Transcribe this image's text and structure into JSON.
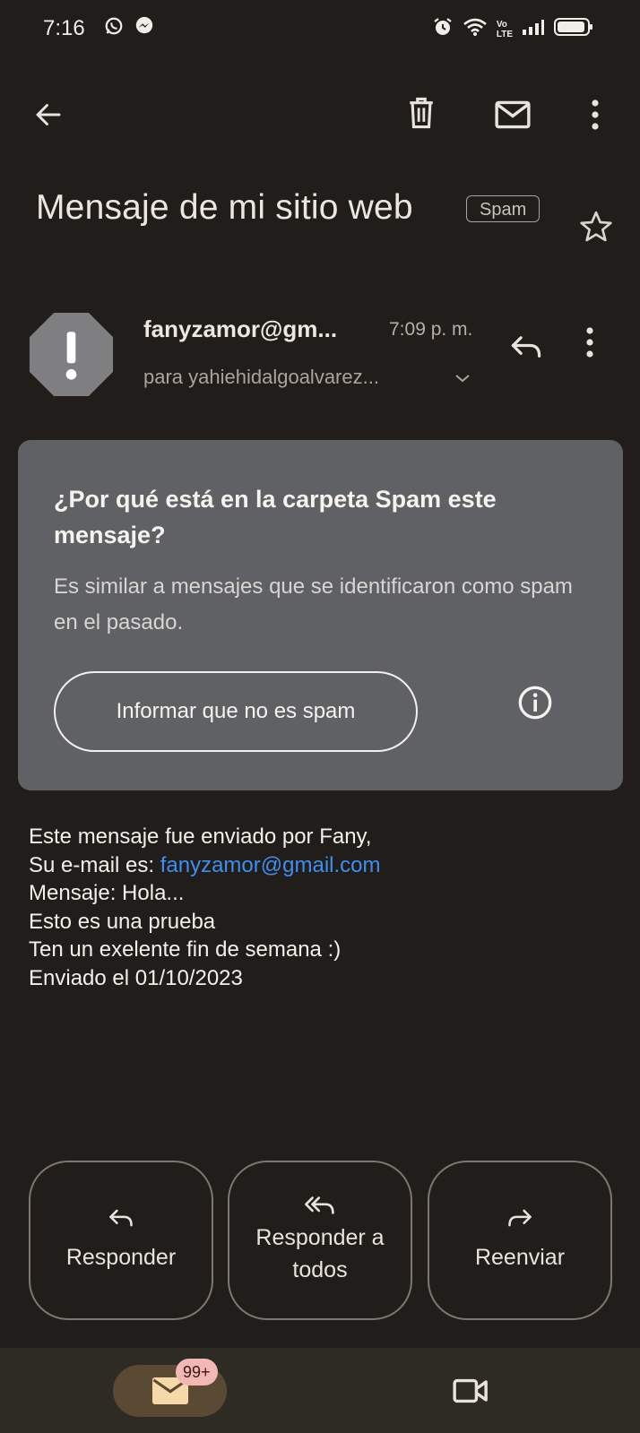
{
  "status_bar": {
    "time": "7:16",
    "left_icons": [
      "whatsapp-icon",
      "messenger-icon"
    ],
    "right_icons": [
      "alarm-icon",
      "wifi-icon",
      "volte-icon",
      "signal-icon",
      "battery-icon"
    ],
    "volte_top": "Vo",
    "volte_bottom": "LTE"
  },
  "toolbar": {
    "back_icon": "arrow-left-icon",
    "delete_icon": "trash-icon",
    "mark_unread_icon": "mail-icon",
    "more_icon": "more-vert-icon"
  },
  "email": {
    "subject": "Mensaje de mi sitio web",
    "label": "Spam",
    "sender": "fanyzamor@gm...",
    "time": "7:09 p. m.",
    "recipient": "para yahiehidalgoalvarez...",
    "body_lines": [
      "Este mensaje fue enviado por Fany,",
      "Mensaje: Hola...",
      "Esto es una prueba",
      "Ten un exelente fin de semana :)",
      "Enviado el 01/10/2023"
    ],
    "email_prefix": "Su e-mail es: ",
    "email_link": "fanyzamor@gmail.com"
  },
  "spam_card": {
    "title": "¿Por qué está en la carpeta Spam este mensaje?",
    "text": "Es similar a mensajes que se identificaron como spam en el pasado.",
    "button": "Informar que no es spam"
  },
  "actions": {
    "reply": "Responder",
    "reply_all_line1": "Responder a",
    "reply_all_line2": "todos",
    "forward": "Reenviar"
  },
  "bottom_nav": {
    "badge": "99+"
  },
  "colors": {
    "background": "#201d1a",
    "card": "#5f6164",
    "link": "#3f8ef0",
    "badge": "#f2b8b5"
  }
}
